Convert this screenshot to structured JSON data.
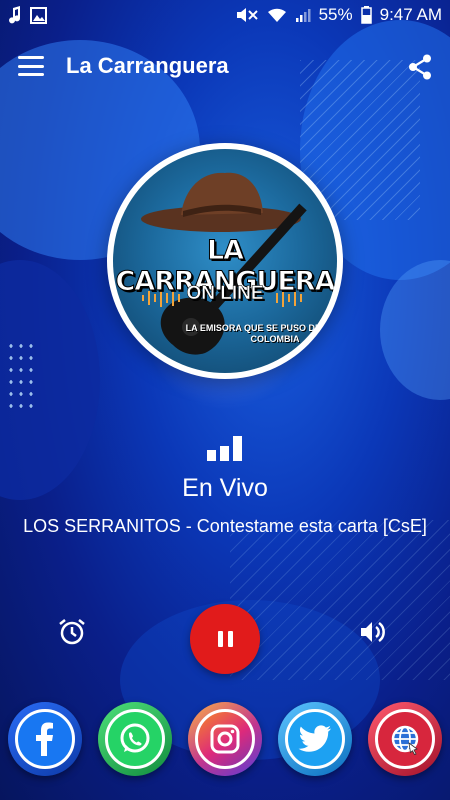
{
  "status_bar": {
    "battery_percent": "55%",
    "time": "9:47 AM",
    "left_icons": [
      "music-note-icon",
      "image-icon"
    ],
    "right_icons": [
      "mute-icon",
      "wifi-icon",
      "signal-icon",
      "battery-icon"
    ]
  },
  "app_bar": {
    "title": "La Carranguera",
    "menu_icon": "hamburger-menu-icon",
    "share_icon": "share-icon"
  },
  "logo": {
    "line1": "LA CARRANGUERA",
    "line2": "ON LINE",
    "line3": "LA EMISORA QUE SE PUSO DE RUANA A COLOMBIA"
  },
  "player": {
    "status": "En Vivo",
    "track": "LOS SERRANITOS - Contestame esta carta [CsE]",
    "signal_icon": "signal-bars-icon",
    "alarm_icon": "alarm-clock-icon",
    "pause_icon": "pause-icon",
    "volume_icon": "volume-icon"
  },
  "socials": [
    {
      "name": "facebook",
      "icon": "facebook-icon",
      "color": "#1877f2"
    },
    {
      "name": "whatsapp",
      "icon": "whatsapp-icon",
      "color": "#25d366"
    },
    {
      "name": "instagram",
      "icon": "instagram-icon",
      "color": "#c1358f"
    },
    {
      "name": "twitter",
      "icon": "twitter-icon",
      "color": "#1da1f2"
    },
    {
      "name": "website",
      "icon": "globe-icon",
      "color": "#d7263d"
    }
  ],
  "colors": {
    "background": "#0b38b8",
    "accent_red": "#e11b1b",
    "text": "#ffffff"
  }
}
